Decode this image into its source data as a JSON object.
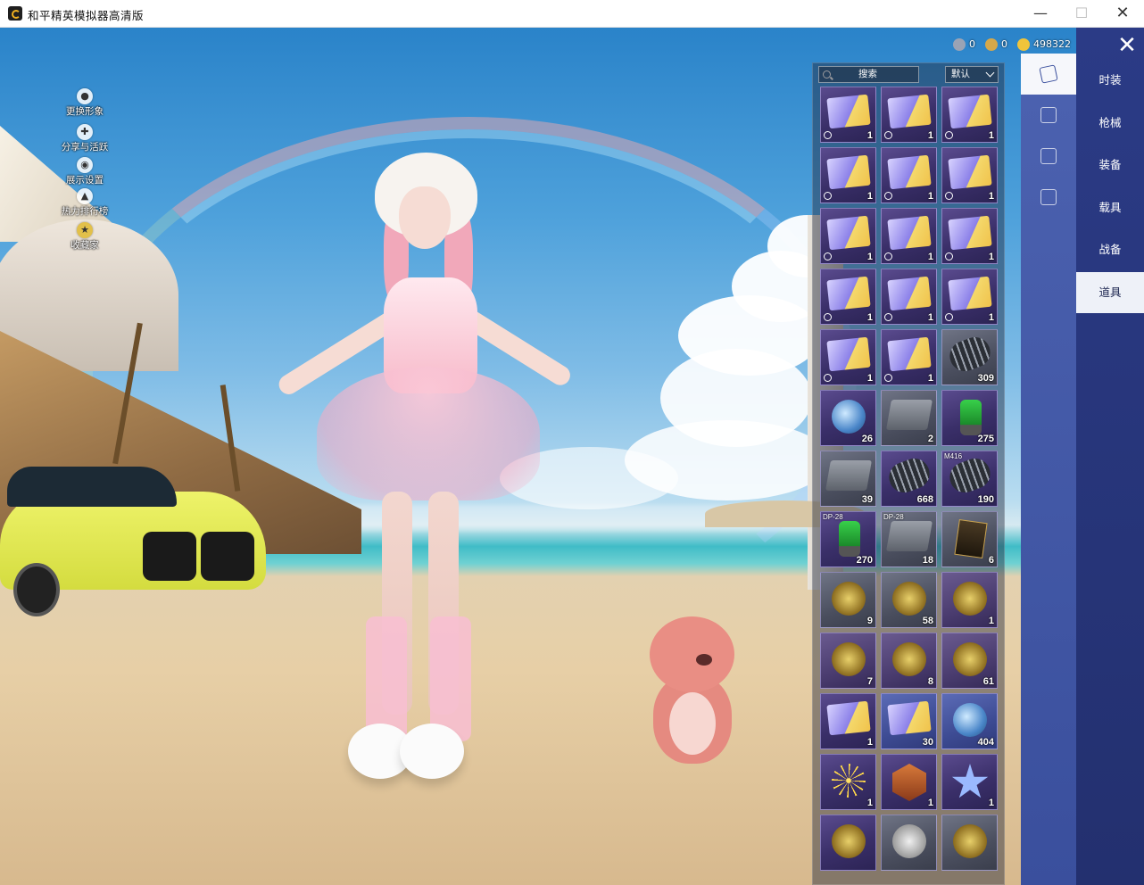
{
  "window": {
    "title": "和平精英模拟器高清版"
  },
  "side_menu": [
    {
      "label": "更换形象",
      "icon": "person-icon"
    },
    {
      "label": "分享与活跃",
      "icon": "share-icon"
    },
    {
      "label": "展示设置",
      "icon": "eye-icon"
    },
    {
      "label": "热力排行榜",
      "icon": "fire-icon"
    },
    {
      "label": "收藏家",
      "icon": "collector-icon"
    }
  ],
  "currency": [
    {
      "icon": "silver-coin-icon",
      "value": "0",
      "color": "#9aa3b5"
    },
    {
      "icon": "gold-medal-icon",
      "value": "0",
      "color": "#d6a84a"
    },
    {
      "icon": "gold-coin-icon",
      "value": "498322",
      "color": "#f0c43a"
    }
  ],
  "inventory": {
    "search_label": "搜索",
    "sort_label": "默认",
    "items": [
      {
        "art": "ticket",
        "qty": "1",
        "timed": true,
        "style": "purple"
      },
      {
        "art": "ticket",
        "qty": "1",
        "timed": true,
        "style": "purple"
      },
      {
        "art": "ticket",
        "qty": "1",
        "timed": true,
        "style": "purple"
      },
      {
        "art": "ticket",
        "qty": "1",
        "timed": true,
        "style": "purple"
      },
      {
        "art": "ticket",
        "qty": "1",
        "timed": true,
        "style": "purple"
      },
      {
        "art": "ticket",
        "qty": "1",
        "timed": true,
        "style": "purple"
      },
      {
        "art": "ticket",
        "qty": "1",
        "timed": true,
        "style": "purple"
      },
      {
        "art": "ticket",
        "qty": "1",
        "timed": true,
        "style": "purple"
      },
      {
        "art": "ticket",
        "qty": "1",
        "timed": true,
        "style": "purple"
      },
      {
        "art": "ticket",
        "qty": "1",
        "timed": true,
        "style": "purple"
      },
      {
        "art": "ticket",
        "qty": "1",
        "timed": true,
        "style": "purple"
      },
      {
        "art": "ticket",
        "qty": "1",
        "timed": true,
        "style": "purple"
      },
      {
        "art": "ticket",
        "qty": "1",
        "timed": true,
        "style": "purple"
      },
      {
        "art": "ticket",
        "qty": "1",
        "timed": true,
        "style": "purple"
      },
      {
        "art": "spring",
        "qty": "309",
        "timed": false,
        "style": "gray"
      },
      {
        "art": "orb",
        "qty": "26",
        "timed": false,
        "style": "purple"
      },
      {
        "art": "box",
        "qty": "2",
        "timed": false,
        "style": "gray"
      },
      {
        "art": "can",
        "qty": "275",
        "timed": false,
        "style": "purple"
      },
      {
        "art": "box",
        "qty": "39",
        "timed": false,
        "style": "gray"
      },
      {
        "art": "spring",
        "qty": "668",
        "timed": false,
        "style": "purple"
      },
      {
        "art": "spring",
        "qty": "190",
        "timed": false,
        "style": "purple",
        "tag": "M416"
      },
      {
        "art": "can",
        "qty": "270",
        "timed": false,
        "style": "purple",
        "tag": "DP-28"
      },
      {
        "art": "box",
        "qty": "18",
        "timed": false,
        "style": "gray",
        "tag": "DP-28"
      },
      {
        "art": "card",
        "qty": "6",
        "timed": false,
        "style": "gray"
      },
      {
        "art": "badge",
        "qty": "9",
        "timed": false,
        "style": "gray"
      },
      {
        "art": "badge",
        "qty": "58",
        "timed": false,
        "style": "gray"
      },
      {
        "art": "badge",
        "qty": "1",
        "timed": false,
        "style": "gold"
      },
      {
        "art": "badge",
        "qty": "7",
        "timed": false,
        "style": "gold"
      },
      {
        "art": "badge",
        "qty": "8",
        "timed": false,
        "style": "gold"
      },
      {
        "art": "badge",
        "qty": "61",
        "timed": false,
        "style": "gold"
      },
      {
        "art": "ticket",
        "qty": "1",
        "timed": false,
        "style": "purple"
      },
      {
        "art": "ticket",
        "qty": "30",
        "timed": false,
        "style": "blue"
      },
      {
        "art": "orb",
        "qty": "404",
        "timed": false,
        "style": "blue"
      },
      {
        "art": "firework",
        "qty": "1",
        "timed": false,
        "style": "purple"
      },
      {
        "art": "medal",
        "qty": "1",
        "timed": false,
        "style": "purple"
      },
      {
        "art": "star",
        "qty": "1",
        "timed": false,
        "style": "purple"
      },
      {
        "art": "badge",
        "qty": "",
        "timed": false,
        "style": "purple"
      },
      {
        "art": "coin",
        "qty": "",
        "timed": false,
        "style": "gray"
      },
      {
        "art": "badge",
        "qty": "",
        "timed": false,
        "style": "gray"
      }
    ]
  },
  "subtabs": [
    {
      "icon": "card-icon",
      "active": true
    },
    {
      "icon": "calendar-icon",
      "active": false
    },
    {
      "icon": "sparkle-icon",
      "active": false
    },
    {
      "icon": "ticket-icon",
      "active": false
    }
  ],
  "categories": [
    {
      "label": "时装",
      "active": false
    },
    {
      "label": "枪械",
      "active": false
    },
    {
      "label": "装备",
      "active": false
    },
    {
      "label": "载具",
      "active": false
    },
    {
      "label": "战备",
      "active": false
    },
    {
      "label": "道具",
      "active": true
    }
  ],
  "close_symbol": "✕"
}
